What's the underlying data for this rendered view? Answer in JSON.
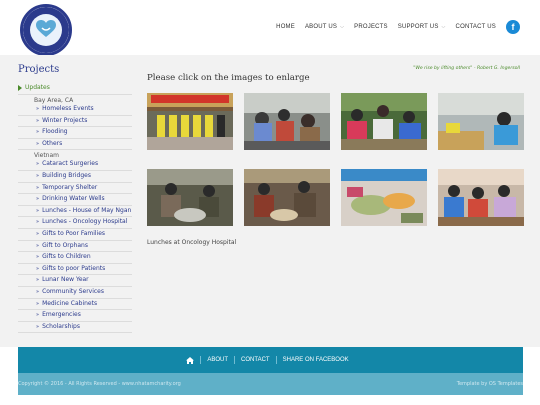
{
  "header": {
    "nav": [
      {
        "label": "HOME",
        "dropdown": false
      },
      {
        "label": "ABOUT US",
        "dropdown": true
      },
      {
        "label": "PROJECTS",
        "dropdown": false
      },
      {
        "label": "SUPPORT US",
        "dropdown": true
      },
      {
        "label": "CONTACT US",
        "dropdown": false
      }
    ],
    "facebook_glyph": "f",
    "logo_icon": "heart-in-hands-icon"
  },
  "sidebar": {
    "title": "Projects",
    "updates_label": "Updates",
    "region1": "Bay Area, CA",
    "bay_items": [
      "Homeless Events",
      "Winter Projects",
      "Flooding",
      "Others"
    ],
    "region2": "Vietnam",
    "vn_items": [
      "Cataract Surgeries",
      "Building Bridges",
      "Temporary Shelter",
      "Drinking Water Wells",
      "Lunches - House of May Ngan",
      "Lunches - Oncology Hospital",
      "Gifts to Poor Families",
      "Gift to Orphans",
      "Gifts to Children",
      "Gifts to poor Patients",
      "Lunar New Year",
      "Community Services",
      "Medicine Cabinets",
      "Emergencies",
      "Scholarships"
    ]
  },
  "main": {
    "quote": "\"We rise by lifting others\" - Robert G. Ingersoll",
    "title": "Please click on the images to enlarge",
    "caption": "Lunches at Oncology Hospital"
  },
  "footer": {
    "links": [
      "ABOUT",
      "CONTACT",
      "SHARE ON FACEBOOK"
    ],
    "home_icon": "home-icon",
    "copyright": "Copyright © 2016 - All Rights Reserved - www.nhatamcharity.org",
    "template": "Template by OS Templates"
  },
  "colors": {
    "accent": "#1387a8",
    "brand": "#2b3a8c",
    "green": "#4a8a2a",
    "facebook": "#1a8ad6"
  }
}
